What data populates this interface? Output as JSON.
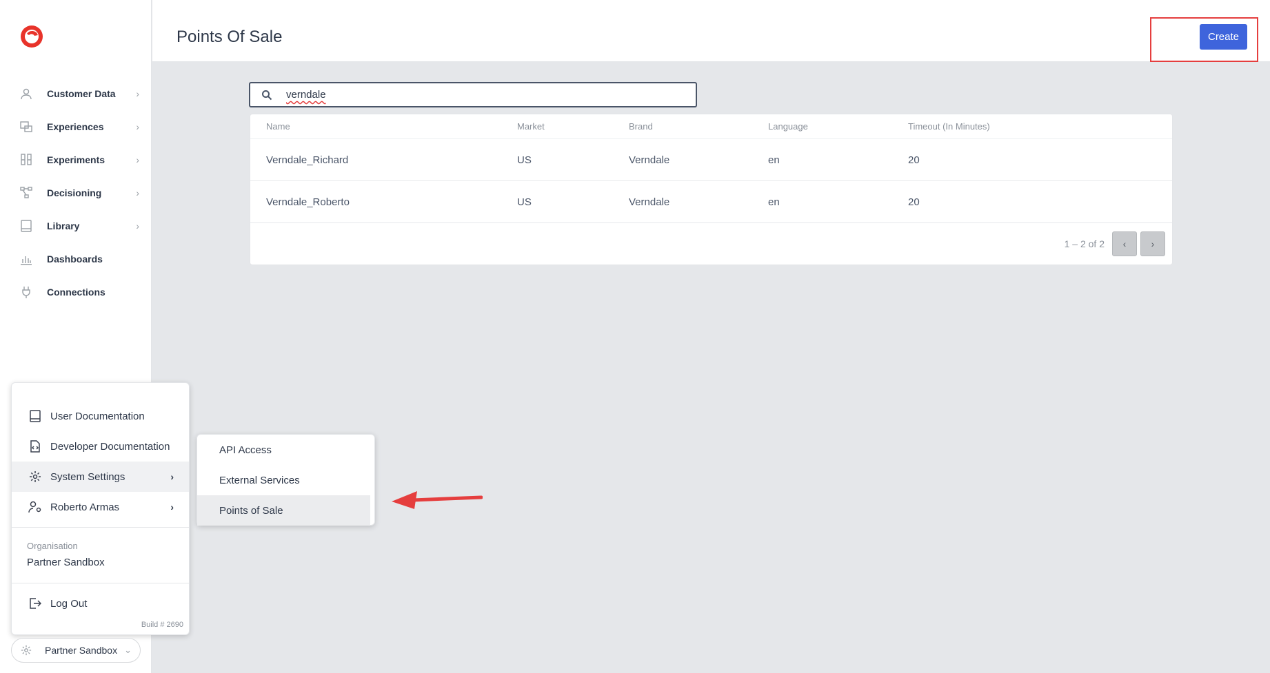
{
  "header": {
    "title": "Points Of Sale",
    "create_label": "Create"
  },
  "sidebar": {
    "items": [
      {
        "label": "Customer Data",
        "icon": "person-icon",
        "has_chevron": true
      },
      {
        "label": "Experiences",
        "icon": "screens-icon",
        "has_chevron": true
      },
      {
        "label": "Experiments",
        "icon": "flask-icon",
        "has_chevron": true
      },
      {
        "label": "Decisioning",
        "icon": "flow-icon",
        "has_chevron": true
      },
      {
        "label": "Library",
        "icon": "book-icon",
        "has_chevron": true
      },
      {
        "label": "Dashboards",
        "icon": "chart-icon",
        "has_chevron": false
      },
      {
        "label": "Connections",
        "icon": "plug-icon",
        "has_chevron": false
      }
    ]
  },
  "search": {
    "value": "verndale"
  },
  "table": {
    "columns": [
      "Name",
      "Market",
      "Brand",
      "Language",
      "Timeout (In Minutes)"
    ],
    "rows": [
      [
        "Verndale_Richard",
        "US",
        "Verndale",
        "en",
        "20"
      ],
      [
        "Verndale_Roberto",
        "US",
        "Verndale",
        "en",
        "20"
      ]
    ],
    "pagination": "1 – 2 of 2"
  },
  "menu": {
    "items": [
      {
        "label": "User Documentation",
        "icon": "book-icon"
      },
      {
        "label": "Developer Documentation",
        "icon": "code-file-icon"
      },
      {
        "label": "System Settings",
        "icon": "gear-icon"
      },
      {
        "label": "Roberto Armas",
        "icon": "user-settings-icon"
      }
    ],
    "org_label": "Organisation",
    "org_name": "Partner Sandbox",
    "logout_label": "Log Out",
    "build": "Build # 2690"
  },
  "submenu": {
    "items": [
      "API Access",
      "External Services",
      "Points of Sale"
    ]
  },
  "workspace": {
    "label": "Partner Sandbox"
  },
  "colors": {
    "accent": "#3e64dc",
    "annotation": "#e53e3e"
  }
}
